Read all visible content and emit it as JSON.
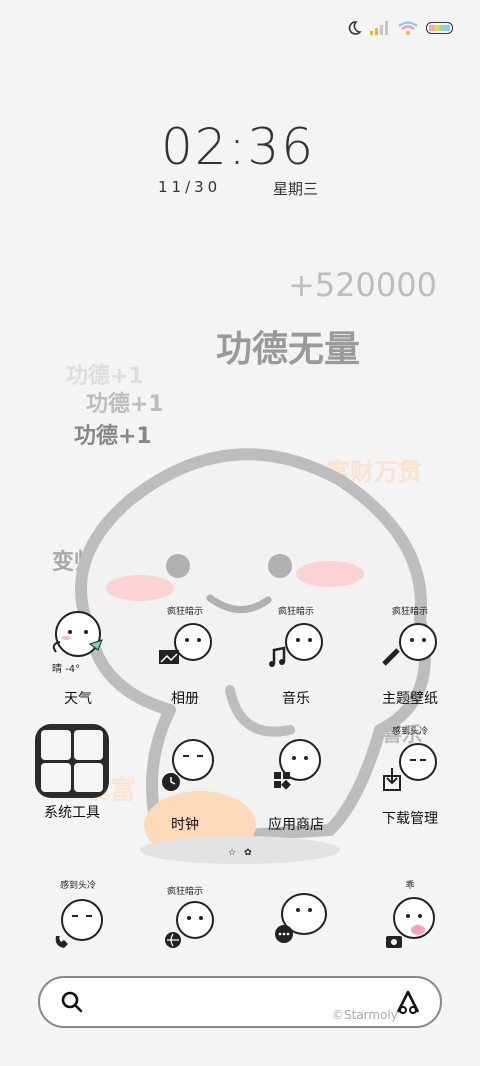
{
  "status": {
    "icons": [
      "moon-icon",
      "signal-icon",
      "wifi-icon",
      "battery-icon"
    ]
  },
  "clock": {
    "time": "02:36",
    "date": "11/30",
    "weekday": "星期三"
  },
  "floaters": {
    "points": "+520000",
    "merit": "功德无量",
    "plus1_a": "功德+1",
    "plus1_b": "功德+1",
    "plus1_c": "功德+1",
    "wealth": "富财万贯",
    "handsome": "变帅",
    "peace": "平安喜乐",
    "rich": "暴富"
  },
  "apps": {
    "weather": {
      "label": "天气",
      "temp": "晴 -4°"
    },
    "gallery": {
      "label": "相册",
      "caption": "疯狂暗示"
    },
    "music": {
      "label": "音乐",
      "caption": "疯狂暗示"
    },
    "theme": {
      "label": "主题壁纸",
      "caption": "疯狂暗示"
    },
    "tools": {
      "label": "系统工具"
    },
    "clock": {
      "label": "时钟"
    },
    "store": {
      "label": "应用商店"
    },
    "downloads": {
      "label": "下载管理",
      "caption": "感到头冷"
    }
  },
  "dock": {
    "phone": {
      "caption": "感到头冷"
    },
    "browser": {
      "caption": "疯狂暗示"
    },
    "messages": {
      "caption": ""
    },
    "camera": {
      "caption": "乖"
    }
  },
  "search": {
    "placeholder": ""
  },
  "watermark": "©Starmoly"
}
